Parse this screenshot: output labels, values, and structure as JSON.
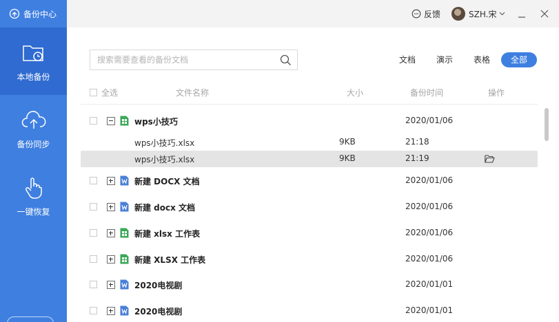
{
  "app": {
    "title": "备份中心"
  },
  "sidebar": {
    "items": [
      {
        "label": "本地备份",
        "icon": "folder-clock-icon"
      },
      {
        "label": "备份同步",
        "icon": "cloud-upload-icon"
      },
      {
        "label": "一键恢复",
        "icon": "hand-pointer-icon"
      }
    ]
  },
  "topbar": {
    "feedback_label": "反馈",
    "username": "SZH.宋"
  },
  "search": {
    "placeholder": "搜索需要查看的备份文档"
  },
  "filters": [
    {
      "label": "文档",
      "active": false
    },
    {
      "label": "演示",
      "active": false
    },
    {
      "label": "表格",
      "active": false
    },
    {
      "label": "全部",
      "active": true
    }
  ],
  "table": {
    "select_all": "全选",
    "columns": {
      "name": "文件名称",
      "size": "大小",
      "time": "备份时间",
      "action": "操作"
    },
    "rows": [
      {
        "name": "wps小技巧",
        "type": "sheet",
        "date": "2020/01/06",
        "expanded": true,
        "children": [
          {
            "name": "wps小技巧.xlsx",
            "size": "9KB",
            "time": "21:18"
          },
          {
            "name": "wps小技巧.xlsx",
            "size": "9KB",
            "time": "21:19",
            "selected": true
          }
        ]
      },
      {
        "name": "新建 DOCX 文档",
        "type": "doc",
        "date": "2020/01/06"
      },
      {
        "name": "新建 docx 文档",
        "type": "doc",
        "date": "2020/01/06"
      },
      {
        "name": "新建 xlsx 工作表",
        "type": "sheet",
        "date": "2020/01/06"
      },
      {
        "name": "新建 XLSX 工作表",
        "type": "sheet",
        "date": "2020/01/06"
      },
      {
        "name": "2020电视剧",
        "type": "doc",
        "date": "2020/01/01"
      },
      {
        "name": "2020电视剧",
        "type": "doc",
        "date": "2020/01/01"
      }
    ]
  },
  "colors": {
    "accent": "#3f7fe0",
    "sidebar_active": "#2f6bd0",
    "sheet_icon": "#3aa856",
    "doc_icon": "#4a7fd6"
  }
}
